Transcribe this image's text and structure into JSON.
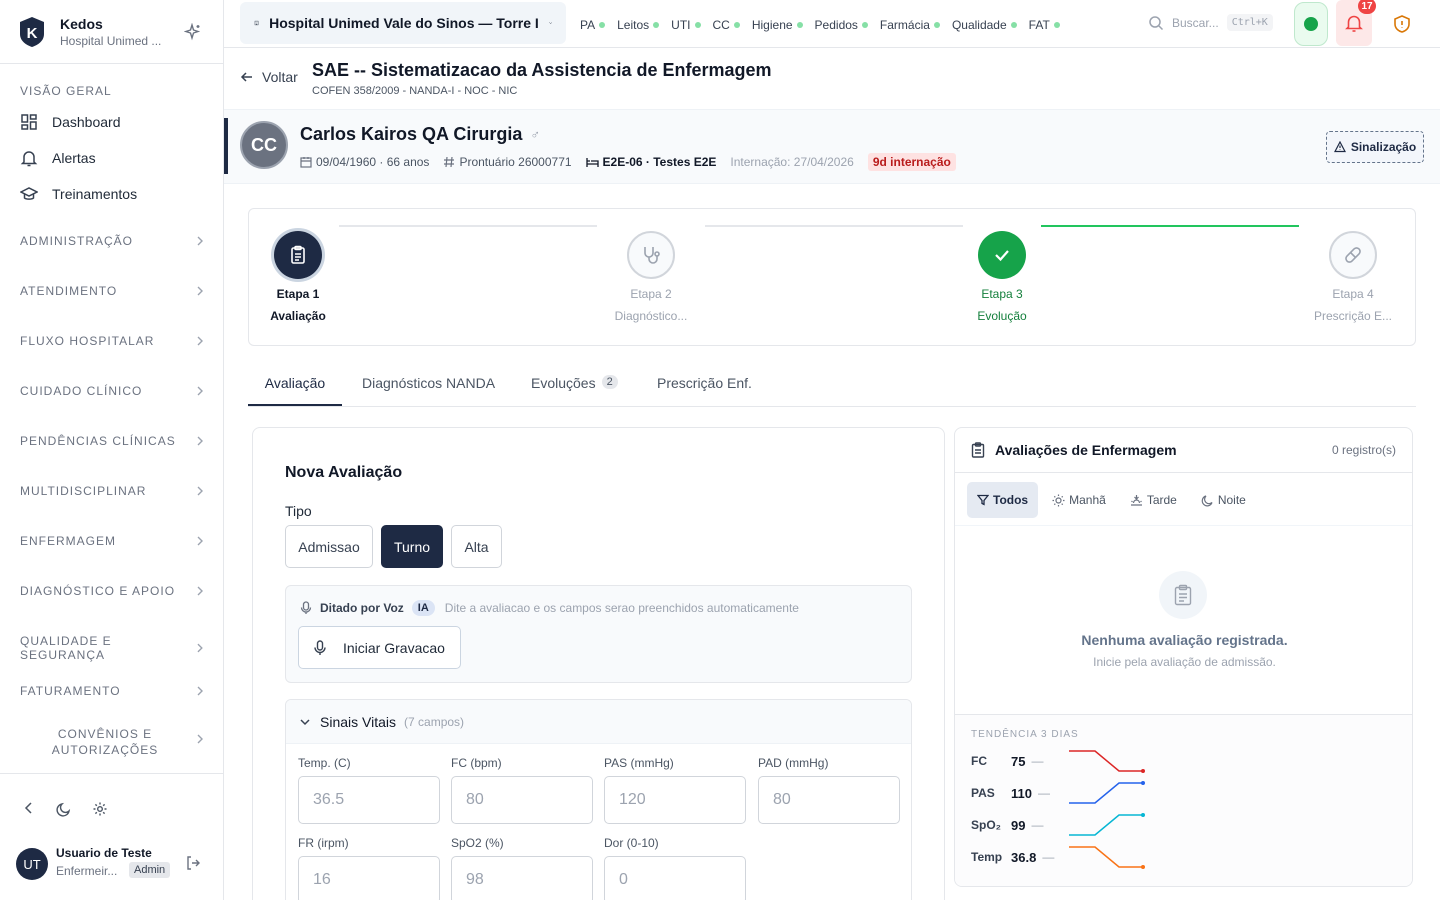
{
  "brand": {
    "name": "Kedos",
    "subtitle": "Hospital Unimed ..."
  },
  "sidebar": {
    "section_title": "VISÃO GERAL",
    "main_items": [
      {
        "label": "Dashboard",
        "icon": "dashboard-icon"
      },
      {
        "label": "Alertas",
        "icon": "bell-icon"
      },
      {
        "label": "Treinamentos",
        "icon": "graduation-cap-icon"
      }
    ],
    "groups": [
      "ADMINISTRAÇÃO",
      "ATENDIMENTO",
      "FLUXO HOSPITALAR",
      "CUIDADO CLÍNICO",
      "PENDÊNCIAS CLÍNICAS",
      "MULTIDISCIPLINAR",
      "ENFERMAGEM",
      "DIAGNÓSTICO E APOIO",
      "QUALIDADE E SEGURANÇA",
      "FATURAMENTO"
    ],
    "group_last": "CONVÊNIOS E AUTORIZAÇÕES",
    "user": {
      "initials": "UT",
      "name": "Usuario de Teste",
      "role": "Enfermeir...",
      "badge": "Admin"
    }
  },
  "topbar": {
    "hospital": "Hospital Unimed Vale do Sinos — Torre I",
    "quick_nav": [
      "PA",
      "Leitos",
      "UTI",
      "CC",
      "Higiene",
      "Pedidos",
      "Farmácia",
      "Qualidade",
      "FAT"
    ],
    "search_placeholder": "Buscar...",
    "search_shortcut": "Ctrl+K",
    "notification_count": "17",
    "colors": {
      "status_ok": "#16a34a",
      "alert": "#ef4444",
      "shield": "#d97706"
    }
  },
  "page": {
    "back_label": "Voltar",
    "title": "SAE -- Sistematizacao da Assistencia de Enfermagem",
    "subtitle": "COFEN 358/2009 - NANDA-I - NOC - NIC"
  },
  "patient": {
    "initials": "CC",
    "name": "Carlos Kairos QA Cirurgia",
    "sex_icon": "male-icon",
    "birth": "09/04/1960 · 66 anos",
    "record_label": "Prontuário",
    "record_number": "26000771",
    "bed": "E2E-06 · Testes E2E",
    "admission": "Internação: 27/04/2026",
    "stay_badge": "9d internação",
    "signal_button": "Sinalização"
  },
  "steps": [
    {
      "label": "Etapa 1",
      "name": "Avaliação",
      "state": "current",
      "icon": "clipboard-icon"
    },
    {
      "label": "Etapa 2",
      "name": "Diagnóstico...",
      "state": "pending",
      "icon": "stethoscope-icon"
    },
    {
      "label": "Etapa 3",
      "name": "Evolução",
      "state": "done",
      "icon": "check-icon"
    },
    {
      "label": "Etapa 4",
      "name": "Prescrição E...",
      "state": "pending",
      "icon": "pill-icon"
    }
  ],
  "tabs": [
    {
      "label": "Avaliação",
      "active": true
    },
    {
      "label": "Diagnósticos NANDA"
    },
    {
      "label": "Evoluções",
      "count": "2"
    },
    {
      "label": "Prescrição Enf."
    }
  ],
  "form": {
    "title": "Nova Avaliação",
    "type_label": "Tipo",
    "types": [
      "Admissao",
      "Turno",
      "Alta"
    ],
    "selected_type": "Turno",
    "voice": {
      "title": "Ditado por Voz",
      "badge": "IA",
      "hint": "Dite a avaliacao e os campos serao preenchidos automaticamente",
      "button": "Iniciar Gravacao"
    },
    "vitals": {
      "title": "Sinais Vitais",
      "count": "(7 campos)",
      "fields": [
        {
          "label": "Temp. (C)",
          "placeholder": "36.5"
        },
        {
          "label": "FC (bpm)",
          "placeholder": "80"
        },
        {
          "label": "PAS (mmHg)",
          "placeholder": "120"
        },
        {
          "label": "PAD (mmHg)",
          "placeholder": "80"
        },
        {
          "label": "FR (irpm)",
          "placeholder": "16"
        },
        {
          "label": "SpO2 (%)",
          "placeholder": "98"
        },
        {
          "label": "Dor (0-10)",
          "placeholder": "0"
        }
      ]
    }
  },
  "assessments": {
    "title": "Avaliações de Enfermagem",
    "count": "0 registro(s)",
    "filters": [
      {
        "label": "Todos",
        "active": true,
        "icon": "filter-icon"
      },
      {
        "label": "Manhã",
        "icon": "sun-icon"
      },
      {
        "label": "Tarde",
        "icon": "sunset-icon"
      },
      {
        "label": "Noite",
        "icon": "moon-icon"
      }
    ],
    "empty_title": "Nenhuma avaliação registrada.",
    "empty_subtitle": "Inicie pela avaliação de admissão.",
    "trend_title": "TENDÊNCIA 3 DIAS",
    "trend": [
      {
        "key": "FC",
        "value": "75",
        "delta": "—",
        "color": "#dc2626"
      },
      {
        "key": "PAS",
        "value": "110",
        "delta": "—",
        "color": "#2563eb"
      },
      {
        "key": "SpO₂",
        "value": "99",
        "delta": "—",
        "color": "#06b6d4"
      },
      {
        "key": "Temp",
        "value": "36.8",
        "delta": "—",
        "color": "#f97316"
      }
    ]
  }
}
